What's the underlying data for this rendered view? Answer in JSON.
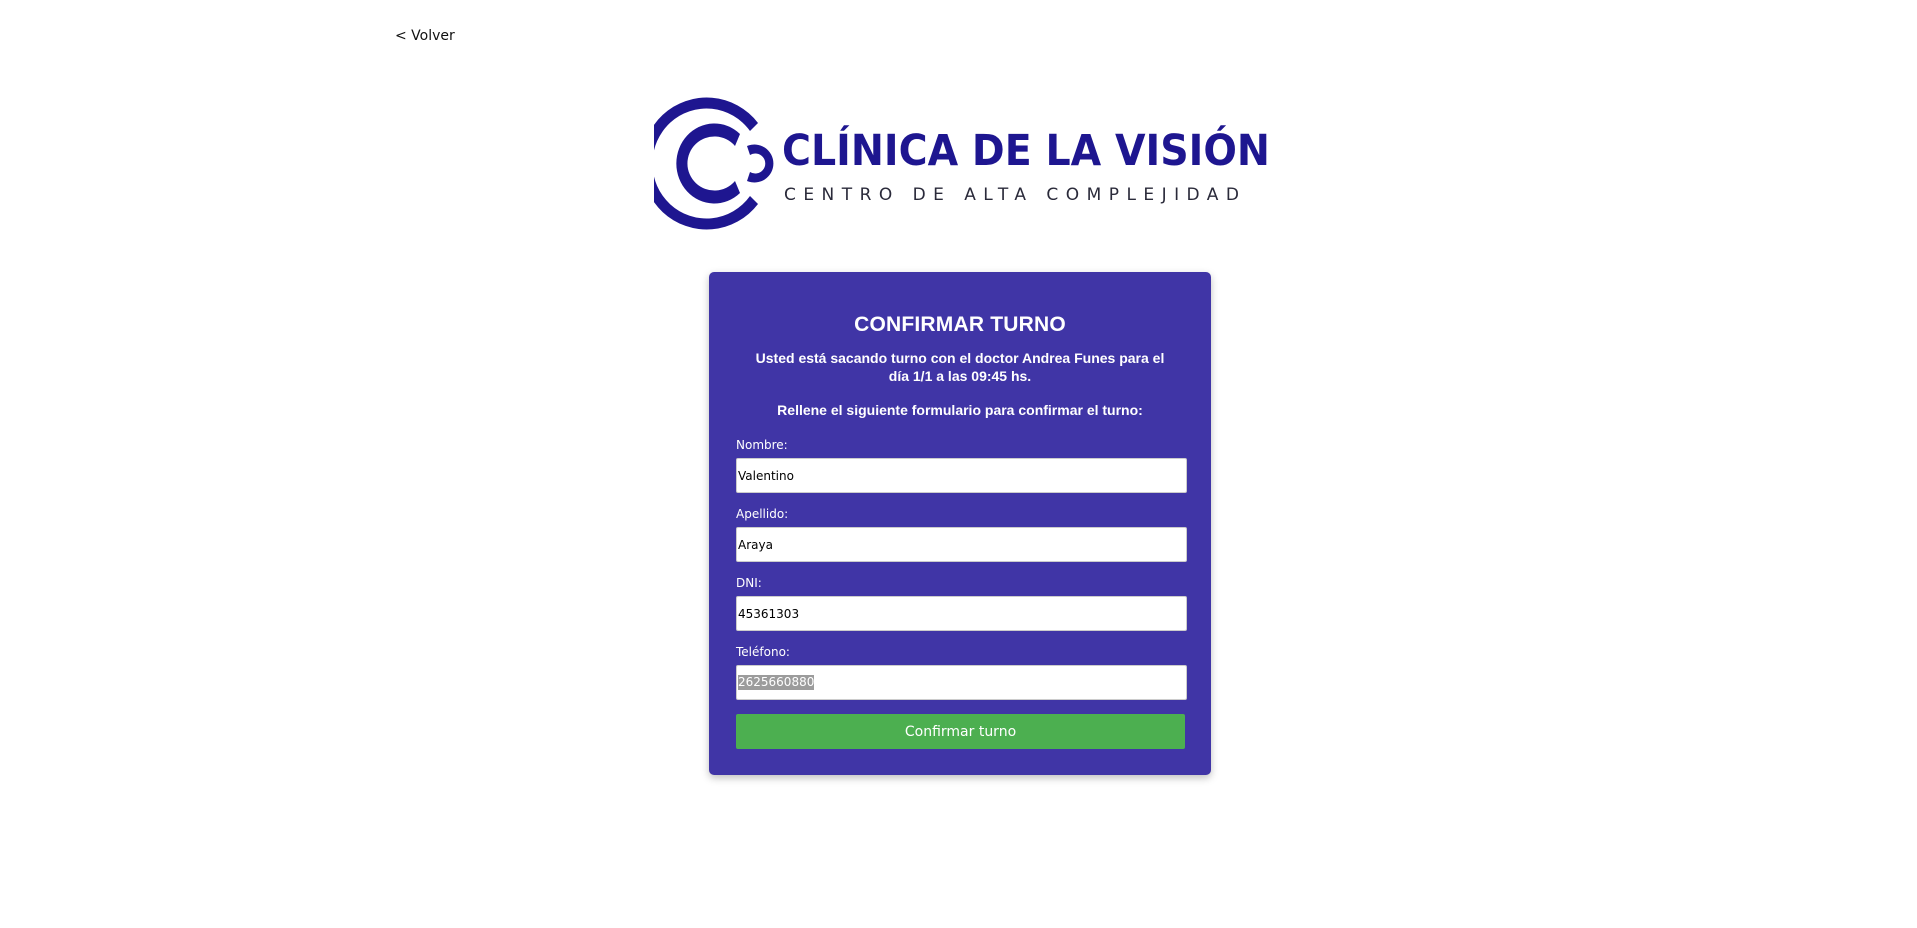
{
  "nav": {
    "back_label": "< Volver"
  },
  "logo": {
    "name": "CLÍNICA DE LA VISIÓN",
    "tagline": "CENTRO DE ALTA COMPLEJIDAD",
    "color": "#1e1690",
    "tagline_color": "#2a2a3a"
  },
  "card": {
    "title": "CONFIRMAR TURNO",
    "message": "Usted está sacando turno con el doctor Andrea Funes para el día 1/1 a las 09:45 hs.",
    "instructions": "Rellene el siguiente formulario para confirmar el turno:",
    "background_color": "#4035a6"
  },
  "form": {
    "fields": [
      {
        "label": "Nombre:",
        "value": "Valentino"
      },
      {
        "label": "Apellido:",
        "value": "Araya"
      },
      {
        "label": "DNI:",
        "value": "45361303"
      },
      {
        "label": "Teléfono:",
        "value": "2625660880",
        "selected": true
      }
    ],
    "submit_label": "Confirmar turno",
    "submit_color": "#4caf50"
  }
}
